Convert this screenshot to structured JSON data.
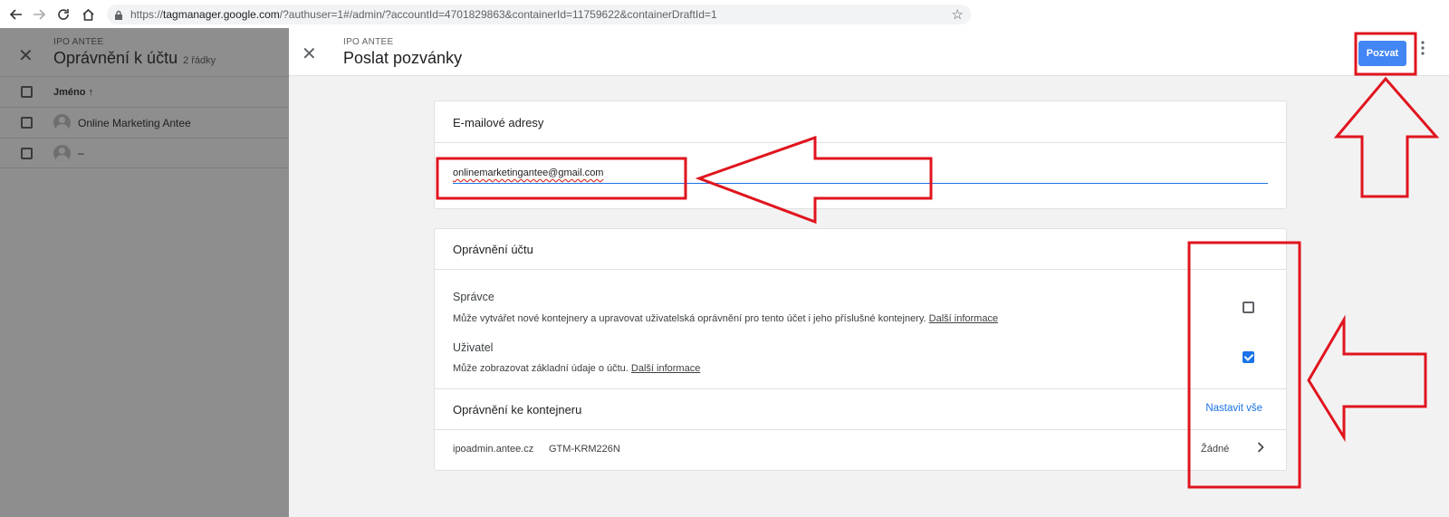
{
  "browser": {
    "url_prefix": "https://",
    "url_host": "tagmanager.google.com",
    "url_path": "/?authuser=1#/admin/?accountId=4701829863&containerId=11759622&containerDraftId=1"
  },
  "left_panel": {
    "subtitle": "IPO ANTEE",
    "title": "Oprávnění k účtu",
    "count": "2 řádky",
    "column_header": "Jméno",
    "rows": [
      {
        "name": "Online Marketing Antee"
      },
      {
        "name": "–"
      }
    ]
  },
  "right_panel": {
    "subtitle": "IPO ANTEE",
    "title": "Poslat pozvánky",
    "invite_label": "Pozvat",
    "email_card": {
      "title": "E-mailové adresy",
      "value": "onlinemarketingantee@gmail.com"
    },
    "permissions_card": {
      "title": "Oprávnění účtu",
      "roles": [
        {
          "name": "Správce",
          "description": "Může vytvářet nové kontejnery a upravovat uživatelská oprávnění pro tento účet i jeho příslušné kontejnery.",
          "link": "Další informace",
          "checked": false
        },
        {
          "name": "Uživatel",
          "description": "Může zobrazovat základní údaje o účtu.",
          "link": "Další informace",
          "checked": true
        }
      ],
      "container_section_title": "Oprávnění ke kontejneru",
      "set_all": "Nastavit vše",
      "container": {
        "domain": "ipoadmin.antee.cz",
        "id": "GTM-KRM226N",
        "permission": "Žádné"
      }
    }
  },
  "colors": {
    "accent": "#4285f4",
    "annotation": "#e0141e",
    "overlay": "#8e8e8e"
  }
}
